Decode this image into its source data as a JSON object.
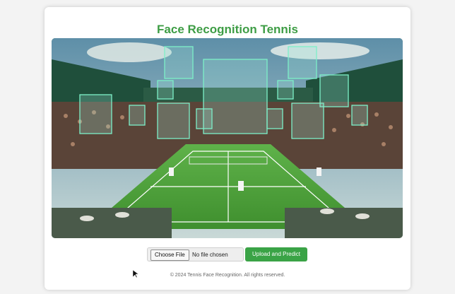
{
  "app": {
    "title": "Face Recognition Tennis"
  },
  "hero": {
    "description_icon": "tennis-stadium-face-scan-image"
  },
  "upload": {
    "choose_label": "Choose File",
    "file_status": "No file chosen",
    "submit_label": "Upload and Predict"
  },
  "footer": {
    "text": "© 2024 Tennis Face Recognition. All rights reserved."
  },
  "colors": {
    "accent": "#3e9d45",
    "button": "#3aa346"
  }
}
